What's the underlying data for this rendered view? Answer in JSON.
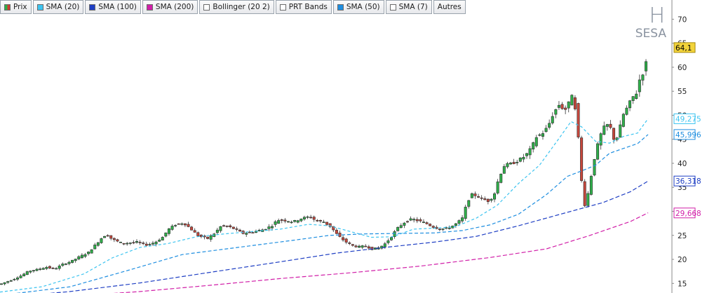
{
  "toolbar": {
    "items": [
      {
        "label": "Prix",
        "swatch": "split",
        "color": "#2fb04a"
      },
      {
        "label": "SMA (20)",
        "swatch": "filled",
        "color": "#3cc4f0"
      },
      {
        "label": "SMA (100)",
        "swatch": "filled",
        "color": "#1f3fc4"
      },
      {
        "label": "SMA (200)",
        "swatch": "filled",
        "color": "#d11fa8"
      },
      {
        "label": "Bollinger (20 2)",
        "swatch": "empty",
        "color": "#ffffff"
      },
      {
        "label": "PRT Bands",
        "swatch": "empty",
        "color": "#ffffff"
      },
      {
        "label": "SMA (50)",
        "swatch": "filled",
        "color": "#1e8ee0"
      },
      {
        "label": "SMA (7)",
        "swatch": "empty",
        "color": "#ffffff"
      },
      {
        "label": "Autres",
        "swatch": "none",
        "color": "#ffffff"
      }
    ]
  },
  "watermark": {
    "letter": "H",
    "ticker": "SESA"
  },
  "chart_data": {
    "type": "candlestick",
    "y_axis": {
      "position": "right",
      "range": [
        13,
        74
      ],
      "ticks": [
        15,
        20,
        25,
        30,
        35,
        40,
        45,
        50,
        55,
        60,
        65,
        70
      ]
    },
    "last_price_label": "64,1",
    "indicator_labels": [
      {
        "name": "SMA (20)",
        "value": "49,275",
        "color": "#3cc4f0"
      },
      {
        "name": "SMA (50)",
        "value": "45,996",
        "color": "#1e8ee0"
      },
      {
        "name": "SMA (100)",
        "value": "36,318",
        "color": "#1f3fc4"
      },
      {
        "name": "SMA (200)",
        "value": "29,668",
        "color": "#d11fa8"
      }
    ],
    "price_path": [
      [
        0,
        14.8
      ],
      [
        18,
        15.8
      ],
      [
        30,
        16.6
      ],
      [
        42,
        17.6
      ],
      [
        54,
        17.9
      ],
      [
        66,
        18.4
      ],
      [
        78,
        18.0
      ],
      [
        90,
        19.0
      ],
      [
        102,
        19.6
      ],
      [
        114,
        20.6
      ],
      [
        126,
        21.4
      ],
      [
        136,
        23.0
      ],
      [
        146,
        24.6
      ],
      [
        152,
        25.2
      ],
      [
        160,
        24.2
      ],
      [
        175,
        23.3
      ],
      [
        195,
        23.6
      ],
      [
        210,
        23.0
      ],
      [
        222,
        23.6
      ],
      [
        232,
        24.6
      ],
      [
        240,
        26.2
      ],
      [
        250,
        27.2
      ],
      [
        262,
        27.6
      ],
      [
        272,
        26.4
      ],
      [
        282,
        25.0
      ],
      [
        296,
        24.3
      ],
      [
        306,
        25.4
      ],
      [
        316,
        27.0
      ],
      [
        326,
        26.8
      ],
      [
        336,
        26.3
      ],
      [
        346,
        25.4
      ],
      [
        360,
        25.7
      ],
      [
        376,
        26.2
      ],
      [
        388,
        27.0
      ],
      [
        396,
        28.2
      ],
      [
        408,
        28.1
      ],
      [
        418,
        27.8
      ],
      [
        430,
        28.5
      ],
      [
        442,
        28.9
      ],
      [
        452,
        28.0
      ],
      [
        462,
        27.8
      ],
      [
        472,
        26.8
      ],
      [
        482,
        25.0
      ],
      [
        492,
        23.8
      ],
      [
        502,
        22.9
      ],
      [
        512,
        22.6
      ],
      [
        522,
        22.8
      ],
      [
        532,
        22.1
      ],
      [
        542,
        22.5
      ],
      [
        550,
        23.3
      ],
      [
        558,
        24.6
      ],
      [
        566,
        26.3
      ],
      [
        576,
        27.6
      ],
      [
        588,
        28.4
      ],
      [
        598,
        28.0
      ],
      [
        608,
        27.5
      ],
      [
        618,
        26.8
      ],
      [
        628,
        26.3
      ],
      [
        636,
        26.4
      ],
      [
        644,
        26.8
      ],
      [
        652,
        27.5
      ],
      [
        660,
        28.6
      ],
      [
        666,
        31.5
      ],
      [
        672,
        33.5
      ],
      [
        680,
        33.3
      ],
      [
        688,
        32.6
      ],
      [
        698,
        32.1
      ],
      [
        706,
        33.8
      ],
      [
        712,
        37.0
      ],
      [
        720,
        39.6
      ],
      [
        730,
        39.9
      ],
      [
        740,
        40.6
      ],
      [
        750,
        41.6
      ],
      [
        758,
        43.1
      ],
      [
        766,
        45.6
      ],
      [
        774,
        46.2
      ],
      [
        782,
        47.6
      ],
      [
        790,
        50.5
      ],
      [
        798,
        52.2
      ],
      [
        806,
        51.0
      ],
      [
        812,
        52.6
      ],
      [
        817,
        54.5
      ],
      [
        822,
        50.3
      ],
      [
        826,
        44.6
      ],
      [
        829,
        38.0
      ],
      [
        832,
        33.0
      ],
      [
        836,
        30.5
      ],
      [
        840,
        34.5
      ],
      [
        844,
        37.6
      ],
      [
        848,
        40.8
      ],
      [
        854,
        44.4
      ],
      [
        860,
        47.1
      ],
      [
        866,
        48.1
      ],
      [
        872,
        47.2
      ],
      [
        878,
        44.1
      ],
      [
        884,
        47.1
      ],
      [
        890,
        50.3
      ],
      [
        896,
        51.8
      ],
      [
        902,
        53.6
      ],
      [
        908,
        54.5
      ],
      [
        914,
        58.1
      ],
      [
        920,
        59.3
      ],
      [
        926,
        64.1
      ]
    ],
    "series": [
      {
        "name": "SMA (20)",
        "color": "#3cc4f0",
        "dash": "4,3",
        "points": [
          [
            0,
            13.2
          ],
          [
            60,
            14.3
          ],
          [
            120,
            17.0
          ],
          [
            160,
            20.3
          ],
          [
            200,
            22.5
          ],
          [
            240,
            23.3
          ],
          [
            280,
            24.7
          ],
          [
            320,
            25.3
          ],
          [
            360,
            25.8
          ],
          [
            400,
            26.3
          ],
          [
            440,
            27.3
          ],
          [
            470,
            27.0
          ],
          [
            500,
            25.8
          ],
          [
            530,
            24.6
          ],
          [
            560,
            24.7
          ],
          [
            590,
            26.3
          ],
          [
            620,
            26.5
          ],
          [
            650,
            26.8
          ],
          [
            680,
            28.6
          ],
          [
            710,
            31.3
          ],
          [
            740,
            35.8
          ],
          [
            770,
            39.6
          ],
          [
            800,
            45.6
          ],
          [
            815,
            48.7
          ],
          [
            830,
            47.6
          ],
          [
            850,
            44.6
          ],
          [
            870,
            44.2
          ],
          [
            890,
            45.6
          ],
          [
            910,
            46.3
          ],
          [
            925,
            49.3
          ]
        ]
      },
      {
        "name": "SMA (50)",
        "color": "#1e8ee0",
        "dash": "5,3",
        "points": [
          [
            0,
            12.5
          ],
          [
            100,
            14.3
          ],
          [
            180,
            17.6
          ],
          [
            260,
            21.0
          ],
          [
            340,
            22.5
          ],
          [
            420,
            24.0
          ],
          [
            470,
            25.0
          ],
          [
            520,
            25.3
          ],
          [
            570,
            25.4
          ],
          [
            620,
            25.5
          ],
          [
            660,
            26.0
          ],
          [
            700,
            27.2
          ],
          [
            740,
            29.4
          ],
          [
            780,
            33.5
          ],
          [
            810,
            37.3
          ],
          [
            830,
            38.4
          ],
          [
            850,
            39.6
          ],
          [
            870,
            42.1
          ],
          [
            890,
            43.1
          ],
          [
            910,
            44.1
          ],
          [
            925,
            46.0
          ]
        ]
      },
      {
        "name": "SMA (100)",
        "color": "#1f3fc4",
        "dash": "6,3",
        "points": [
          [
            0,
            12.0
          ],
          [
            100,
            13.3
          ],
          [
            200,
            15.1
          ],
          [
            300,
            17.3
          ],
          [
            400,
            19.5
          ],
          [
            480,
            21.3
          ],
          [
            550,
            22.5
          ],
          [
            620,
            23.6
          ],
          [
            680,
            24.8
          ],
          [
            740,
            27.0
          ],
          [
            800,
            29.4
          ],
          [
            860,
            31.8
          ],
          [
            900,
            34.1
          ],
          [
            925,
            36.3
          ]
        ]
      },
      {
        "name": "SMA (200)",
        "color": "#d11fa8",
        "dash": "6,3",
        "points": [
          [
            0,
            11.3
          ],
          [
            100,
            12.3
          ],
          [
            200,
            13.3
          ],
          [
            300,
            14.6
          ],
          [
            400,
            16.0
          ],
          [
            500,
            17.2
          ],
          [
            600,
            18.6
          ],
          [
            700,
            20.4
          ],
          [
            780,
            22.2
          ],
          [
            840,
            24.9
          ],
          [
            900,
            27.9
          ],
          [
            925,
            29.7
          ]
        ]
      }
    ]
  }
}
